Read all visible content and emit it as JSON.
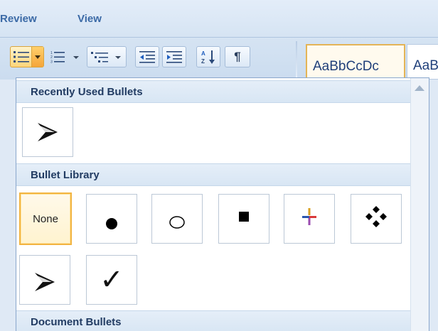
{
  "ribbon": {
    "tabs": [
      {
        "label": "Review"
      },
      {
        "label": "View"
      }
    ],
    "paragraph_group": {
      "pilcrow_label": "¶"
    },
    "styles": [
      {
        "preview": "AaBbCcDc"
      },
      {
        "preview": "AaB"
      }
    ]
  },
  "bullet_dropdown": {
    "recently_used": {
      "header": "Recently Used Bullets",
      "items": [
        {
          "icon": "arrowhead-bullet-icon"
        }
      ]
    },
    "library": {
      "header": "Bullet Library",
      "items": [
        {
          "label": "None",
          "icon": "none",
          "selected": true
        },
        {
          "icon": "filled-circle-bullet-icon"
        },
        {
          "icon": "hollow-circle-bullet-icon"
        },
        {
          "icon": "filled-square-bullet-icon"
        },
        {
          "icon": "four-color-diamond-bullet-icon"
        },
        {
          "icon": "diamond-cluster-bullet-icon"
        },
        {
          "icon": "arrowhead-bullet-icon"
        },
        {
          "label": "✓",
          "icon": "checkmark-bullet-icon"
        }
      ]
    },
    "document": {
      "header": "Document Bullets"
    }
  },
  "colors": {
    "ribbon_tab_text": "#3b6aa6",
    "section_header_bg": "#dde8f5",
    "selected_border": "#f2b441",
    "style_preview_text": "#1f3f7a"
  }
}
